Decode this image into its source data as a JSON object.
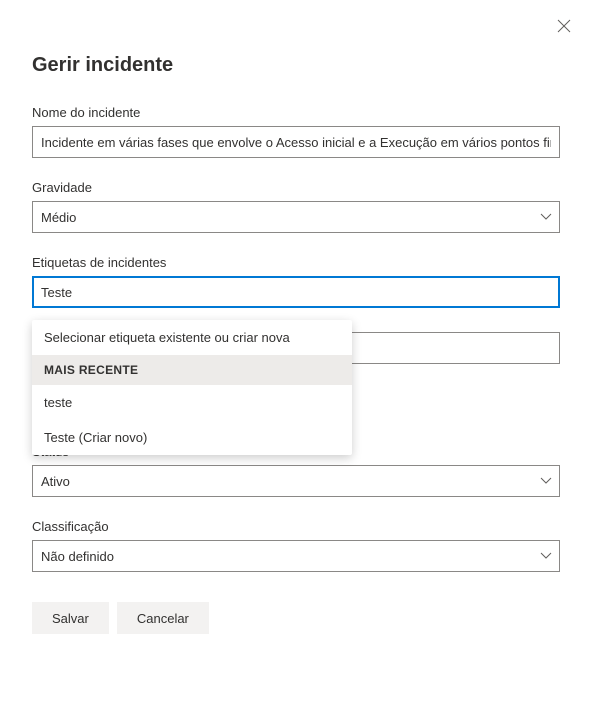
{
  "dialog": {
    "title": "Gerir incidente",
    "close": "Close"
  },
  "fields": {
    "incidentName": {
      "label": "Nome do incidente",
      "value": "Incidente em várias fases que envolve o Acesso inicial e a Execução em vários pontos finais"
    },
    "severity": {
      "label": "Gravidade",
      "value": "Médio"
    },
    "tags": {
      "label": "Etiquetas de incidentes",
      "value": "Teste"
    },
    "status": {
      "label": "Status",
      "value": "Ativo"
    },
    "classification": {
      "label": "Classificação",
      "value": "Não definido"
    }
  },
  "dropdown": {
    "header": "Selecionar etiqueta existente ou criar nova",
    "sectionLabel": "MAIS RECENTE",
    "items": [
      "teste",
      "Teste (Criar novo)"
    ]
  },
  "buttons": {
    "save": "Salvar",
    "cancel": "Cancelar"
  }
}
